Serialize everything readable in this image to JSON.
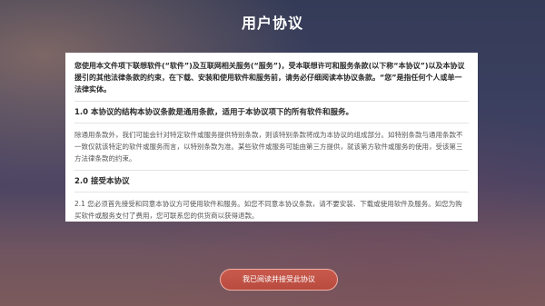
{
  "header": {
    "title": "用户协议"
  },
  "agreement": {
    "intro": "您使用本文件项下联想软件(“软件”)及互联网相关服务(“服务”)，受本联想许可和服务条款(以下称“本协议”)以及本协议援引的其他法律条款的约束，在下载、安装和使用软件和服务前，请务必仔细阅读本协议条款。“您”是指任何个人或单一法律实体。",
    "sections": [
      {
        "heading": "1.0 本协议的结构本协议条款是通用条款，适用于本协议项下的所有软件和服务。",
        "body": "除通用条款外，我们可能会针对特定软件或服务提供特别条款，则该特别条款将成为本协议的组成部分。如特别条款与通用条款不一致仅就该特定的软件或服务而言，以特别条款为准。某些软件或服务可能由第三方提供，就该第方软件或服务的使用，受该第三方法律条款的约束。"
      },
      {
        "heading": "2.0 接受本协议",
        "body": "2.1 您必须首先接受和同意本协议方可使用软件和服务。如您不同意本协议条款，请不要安装、下载或使用软件及服务。如您为购买软件或服务支付了费用，您可联系您的供货商以获得退款。"
      }
    ]
  },
  "footer": {
    "accept_label": "我已阅读并接受此协议"
  }
}
